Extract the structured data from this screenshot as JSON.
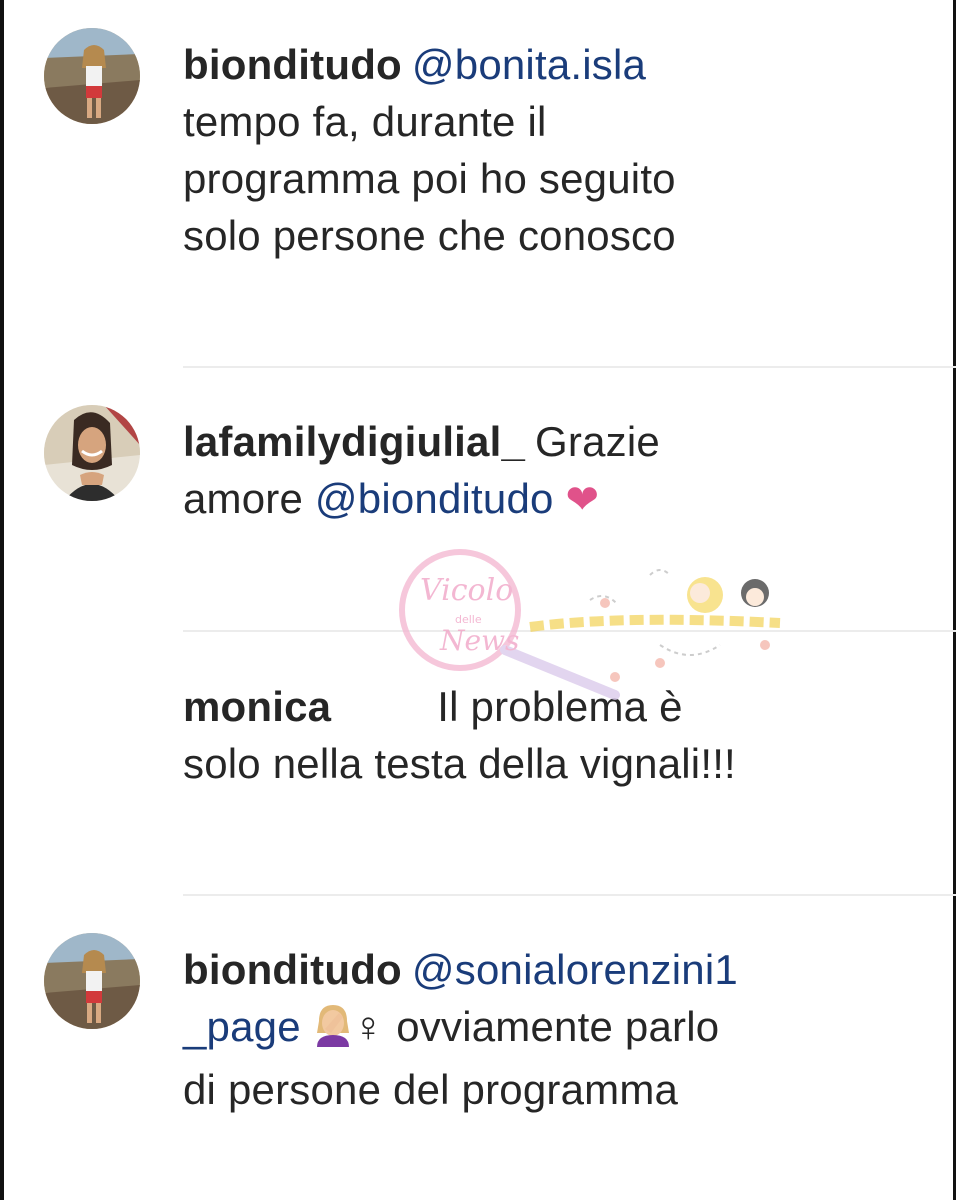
{
  "comments": [
    {
      "username": "bionditudo",
      "mention": "@bonita.isla",
      "lines": [
        "tempo fa, durante il",
        "programma poi ho seguito",
        "solo persone che conosco"
      ],
      "avatar": "bikini-woman-avatar"
    },
    {
      "username": "lafamilydigiulial_",
      "text_before": "Grazie",
      "line2_before": "amore ",
      "mention": "@bionditudo",
      "emoji": "❤",
      "avatar": "smiling-woman-avatar"
    },
    {
      "username": "monica",
      "text_after_gap": "Il problema è",
      "line2": "solo nella testa della vignali!!!"
    },
    {
      "username": "bionditudo",
      "mention_part1": "@sonialorenzini1",
      "mention_part2": "_page",
      "female_sign": "♀",
      "text_rest": " ovviamente parlo",
      "line3": "di persone del programma",
      "avatar": "bikini-woman-avatar"
    }
  ],
  "watermark": {
    "script_text": "Vicolo",
    "small_text": "delle",
    "script_text2": "News"
  },
  "colors": {
    "text": "#262626",
    "mention": "#1a3c7a",
    "heart": "#e0528a",
    "divider": "#ececec"
  }
}
